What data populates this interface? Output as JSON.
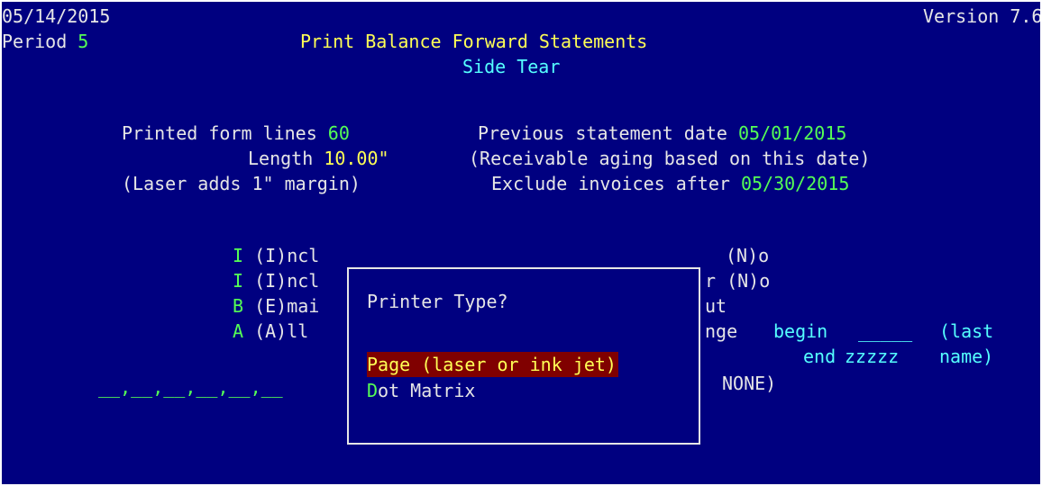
{
  "header": {
    "date": "05/14/2015",
    "version": "Version 7.6",
    "period_label": "Period",
    "period_value": "5",
    "title": "Print Balance Forward Statements",
    "subtitle": "Side Tear"
  },
  "settings": {
    "form_lines_label": "Printed form lines",
    "form_lines_value": "60",
    "length_label": "Length",
    "length_value": "10.00\"",
    "laser_note": "(Laser adds 1\" margin)",
    "prev_stmt_label": "Previous statement date",
    "prev_stmt_value": "05/01/2015",
    "aging_note": "(Receivable aging based on this date)",
    "exclude_label": "Exclude invoices after",
    "exclude_value": "05/30/2015"
  },
  "options": [
    {
      "value": "I",
      "label": "(I)ncl",
      "tail": "(N)o"
    },
    {
      "value": "I",
      "label": "(I)ncl",
      "tail": "r (N)o"
    },
    {
      "value": "B",
      "label": "(E)mai",
      "tail": "ut"
    },
    {
      "value": "A",
      "label": "(A)ll",
      "tail": "nge"
    }
  ],
  "range": {
    "begin_label": "begin",
    "begin_value": "_____",
    "last_label": "(last",
    "end_label": "end",
    "end_value": "zzzzz",
    "name_label": "name)",
    "none_text": "NONE)"
  },
  "fields_row": "__,__,__,__,__,__",
  "popup": {
    "title": "Printer Type?",
    "items": [
      {
        "hotkey": "P",
        "rest": "age (laser or ink jet)",
        "selected": true
      },
      {
        "hotkey": "D",
        "rest": "ot Matrix",
        "selected": false
      }
    ]
  },
  "colors": {
    "background": "#000080",
    "text": "#e6e6e6",
    "title": "#ffff55",
    "value": "#55ff55",
    "subtitle": "#55ffff",
    "selection": "#800000"
  }
}
